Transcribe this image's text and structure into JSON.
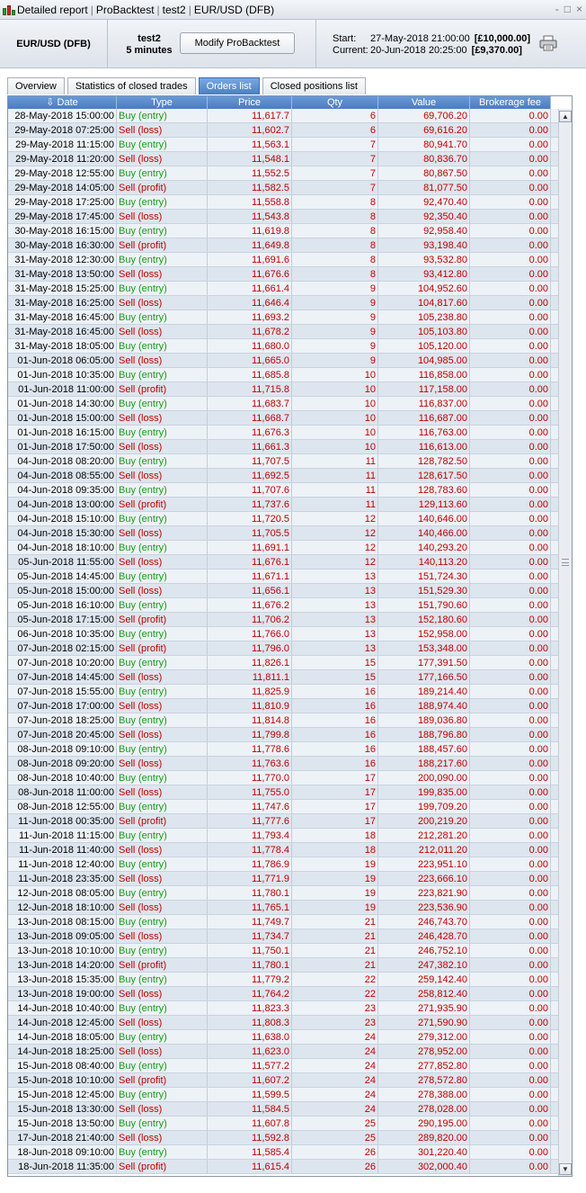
{
  "titlebar": {
    "crumbs": [
      "Detailed report",
      "ProBacktest",
      "test2",
      "EUR/USD (DFB)"
    ],
    "controls": [
      "-",
      "□",
      "×"
    ]
  },
  "header": {
    "instrument": "EUR/USD (DFB)",
    "strategy_name": "test2",
    "timeframe": "5 minutes",
    "modify_button": "Modify ProBacktest",
    "start_label": "Start:",
    "start_date": "27-May-2018 21:00:00",
    "start_amount": "[£10,000.00]",
    "current_label": "Current:",
    "current_date": "20-Jun-2018 20:25:00",
    "current_amount": "[£9,370.00]"
  },
  "tabs": [
    {
      "label": "Overview",
      "active": false
    },
    {
      "label": "Statistics of closed trades",
      "active": false
    },
    {
      "label": "Orders list",
      "active": true
    },
    {
      "label": "Closed positions list",
      "active": false
    }
  ],
  "columns": [
    "Date",
    "Type",
    "Price",
    "Qty",
    "Value",
    "Brokerage fee"
  ],
  "sort_icon": "arrow-down-icon",
  "orders": [
    [
      "28-May-2018 15:00:00",
      "Buy (entry)",
      "11,617.7",
      "6",
      "69,706.20",
      "0.00"
    ],
    [
      "29-May-2018 07:25:00",
      "Sell (loss)",
      "11,602.7",
      "6",
      "69,616.20",
      "0.00"
    ],
    [
      "29-May-2018 11:15:00",
      "Buy (entry)",
      "11,563.1",
      "7",
      "80,941.70",
      "0.00"
    ],
    [
      "29-May-2018 11:20:00",
      "Sell (loss)",
      "11,548.1",
      "7",
      "80,836.70",
      "0.00"
    ],
    [
      "29-May-2018 12:55:00",
      "Buy (entry)",
      "11,552.5",
      "7",
      "80,867.50",
      "0.00"
    ],
    [
      "29-May-2018 14:05:00",
      "Sell (profit)",
      "11,582.5",
      "7",
      "81,077.50",
      "0.00"
    ],
    [
      "29-May-2018 17:25:00",
      "Buy (entry)",
      "11,558.8",
      "8",
      "92,470.40",
      "0.00"
    ],
    [
      "29-May-2018 17:45:00",
      "Sell (loss)",
      "11,543.8",
      "8",
      "92,350.40",
      "0.00"
    ],
    [
      "30-May-2018 16:15:00",
      "Buy (entry)",
      "11,619.8",
      "8",
      "92,958.40",
      "0.00"
    ],
    [
      "30-May-2018 16:30:00",
      "Sell (profit)",
      "11,649.8",
      "8",
      "93,198.40",
      "0.00"
    ],
    [
      "31-May-2018 12:30:00",
      "Buy (entry)",
      "11,691.6",
      "8",
      "93,532.80",
      "0.00"
    ],
    [
      "31-May-2018 13:50:00",
      "Sell (loss)",
      "11,676.6",
      "8",
      "93,412.80",
      "0.00"
    ],
    [
      "31-May-2018 15:25:00",
      "Buy (entry)",
      "11,661.4",
      "9",
      "104,952.60",
      "0.00"
    ],
    [
      "31-May-2018 16:25:00",
      "Sell (loss)",
      "11,646.4",
      "9",
      "104,817.60",
      "0.00"
    ],
    [
      "31-May-2018 16:45:00",
      "Buy (entry)",
      "11,693.2",
      "9",
      "105,238.80",
      "0.00"
    ],
    [
      "31-May-2018 16:45:00",
      "Sell (loss)",
      "11,678.2",
      "9",
      "105,103.80",
      "0.00"
    ],
    [
      "31-May-2018 18:05:00",
      "Buy (entry)",
      "11,680.0",
      "9",
      "105,120.00",
      "0.00"
    ],
    [
      "01-Jun-2018 06:05:00",
      "Sell (loss)",
      "11,665.0",
      "9",
      "104,985.00",
      "0.00"
    ],
    [
      "01-Jun-2018 10:35:00",
      "Buy (entry)",
      "11,685.8",
      "10",
      "116,858.00",
      "0.00"
    ],
    [
      "01-Jun-2018 11:00:00",
      "Sell (profit)",
      "11,715.8",
      "10",
      "117,158.00",
      "0.00"
    ],
    [
      "01-Jun-2018 14:30:00",
      "Buy (entry)",
      "11,683.7",
      "10",
      "116,837.00",
      "0.00"
    ],
    [
      "01-Jun-2018 15:00:00",
      "Sell (loss)",
      "11,668.7",
      "10",
      "116,687.00",
      "0.00"
    ],
    [
      "01-Jun-2018 16:15:00",
      "Buy (entry)",
      "11,676.3",
      "10",
      "116,763.00",
      "0.00"
    ],
    [
      "01-Jun-2018 17:50:00",
      "Sell (loss)",
      "11,661.3",
      "10",
      "116,613.00",
      "0.00"
    ],
    [
      "04-Jun-2018 08:20:00",
      "Buy (entry)",
      "11,707.5",
      "11",
      "128,782.50",
      "0.00"
    ],
    [
      "04-Jun-2018 08:55:00",
      "Sell (loss)",
      "11,692.5",
      "11",
      "128,617.50",
      "0.00"
    ],
    [
      "04-Jun-2018 09:35:00",
      "Buy (entry)",
      "11,707.6",
      "11",
      "128,783.60",
      "0.00"
    ],
    [
      "04-Jun-2018 13:00:00",
      "Sell (profit)",
      "11,737.6",
      "11",
      "129,113.60",
      "0.00"
    ],
    [
      "04-Jun-2018 15:10:00",
      "Buy (entry)",
      "11,720.5",
      "12",
      "140,646.00",
      "0.00"
    ],
    [
      "04-Jun-2018 15:30:00",
      "Sell (loss)",
      "11,705.5",
      "12",
      "140,466.00",
      "0.00"
    ],
    [
      "04-Jun-2018 18:10:00",
      "Buy (entry)",
      "11,691.1",
      "12",
      "140,293.20",
      "0.00"
    ],
    [
      "05-Jun-2018 11:55:00",
      "Sell (loss)",
      "11,676.1",
      "12",
      "140,113.20",
      "0.00"
    ],
    [
      "05-Jun-2018 14:45:00",
      "Buy (entry)",
      "11,671.1",
      "13",
      "151,724.30",
      "0.00"
    ],
    [
      "05-Jun-2018 15:00:00",
      "Sell (loss)",
      "11,656.1",
      "13",
      "151,529.30",
      "0.00"
    ],
    [
      "05-Jun-2018 16:10:00",
      "Buy (entry)",
      "11,676.2",
      "13",
      "151,790.60",
      "0.00"
    ],
    [
      "05-Jun-2018 17:15:00",
      "Sell (profit)",
      "11,706.2",
      "13",
      "152,180.60",
      "0.00"
    ],
    [
      "06-Jun-2018 10:35:00",
      "Buy (entry)",
      "11,766.0",
      "13",
      "152,958.00",
      "0.00"
    ],
    [
      "07-Jun-2018 02:15:00",
      "Sell (profit)",
      "11,796.0",
      "13",
      "153,348.00",
      "0.00"
    ],
    [
      "07-Jun-2018 10:20:00",
      "Buy (entry)",
      "11,826.1",
      "15",
      "177,391.50",
      "0.00"
    ],
    [
      "07-Jun-2018 14:45:00",
      "Sell (loss)",
      "11,811.1",
      "15",
      "177,166.50",
      "0.00"
    ],
    [
      "07-Jun-2018 15:55:00",
      "Buy (entry)",
      "11,825.9",
      "16",
      "189,214.40",
      "0.00"
    ],
    [
      "07-Jun-2018 17:00:00",
      "Sell (loss)",
      "11,810.9",
      "16",
      "188,974.40",
      "0.00"
    ],
    [
      "07-Jun-2018 18:25:00",
      "Buy (entry)",
      "11,814.8",
      "16",
      "189,036.80",
      "0.00"
    ],
    [
      "07-Jun-2018 20:45:00",
      "Sell (loss)",
      "11,799.8",
      "16",
      "188,796.80",
      "0.00"
    ],
    [
      "08-Jun-2018 09:10:00",
      "Buy (entry)",
      "11,778.6",
      "16",
      "188,457.60",
      "0.00"
    ],
    [
      "08-Jun-2018 09:20:00",
      "Sell (loss)",
      "11,763.6",
      "16",
      "188,217.60",
      "0.00"
    ],
    [
      "08-Jun-2018 10:40:00",
      "Buy (entry)",
      "11,770.0",
      "17",
      "200,090.00",
      "0.00"
    ],
    [
      "08-Jun-2018 11:00:00",
      "Sell (loss)",
      "11,755.0",
      "17",
      "199,835.00",
      "0.00"
    ],
    [
      "08-Jun-2018 12:55:00",
      "Buy (entry)",
      "11,747.6",
      "17",
      "199,709.20",
      "0.00"
    ],
    [
      "11-Jun-2018 00:35:00",
      "Sell (profit)",
      "11,777.6",
      "17",
      "200,219.20",
      "0.00"
    ],
    [
      "11-Jun-2018 11:15:00",
      "Buy (entry)",
      "11,793.4",
      "18",
      "212,281.20",
      "0.00"
    ],
    [
      "11-Jun-2018 11:40:00",
      "Sell (loss)",
      "11,778.4",
      "18",
      "212,011.20",
      "0.00"
    ],
    [
      "11-Jun-2018 12:40:00",
      "Buy (entry)",
      "11,786.9",
      "19",
      "223,951.10",
      "0.00"
    ],
    [
      "11-Jun-2018 23:35:00",
      "Sell (loss)",
      "11,771.9",
      "19",
      "223,666.10",
      "0.00"
    ],
    [
      "12-Jun-2018 08:05:00",
      "Buy (entry)",
      "11,780.1",
      "19",
      "223,821.90",
      "0.00"
    ],
    [
      "12-Jun-2018 18:10:00",
      "Sell (loss)",
      "11,765.1",
      "19",
      "223,536.90",
      "0.00"
    ],
    [
      "13-Jun-2018 08:15:00",
      "Buy (entry)",
      "11,749.7",
      "21",
      "246,743.70",
      "0.00"
    ],
    [
      "13-Jun-2018 09:05:00",
      "Sell (loss)",
      "11,734.7",
      "21",
      "246,428.70",
      "0.00"
    ],
    [
      "13-Jun-2018 10:10:00",
      "Buy (entry)",
      "11,750.1",
      "21",
      "246,752.10",
      "0.00"
    ],
    [
      "13-Jun-2018 14:20:00",
      "Sell (profit)",
      "11,780.1",
      "21",
      "247,382.10",
      "0.00"
    ],
    [
      "13-Jun-2018 15:35:00",
      "Buy (entry)",
      "11,779.2",
      "22",
      "259,142.40",
      "0.00"
    ],
    [
      "13-Jun-2018 19:00:00",
      "Sell (loss)",
      "11,764.2",
      "22",
      "258,812.40",
      "0.00"
    ],
    [
      "14-Jun-2018 10:40:00",
      "Buy (entry)",
      "11,823.3",
      "23",
      "271,935.90",
      "0.00"
    ],
    [
      "14-Jun-2018 12:45:00",
      "Sell (loss)",
      "11,808.3",
      "23",
      "271,590.90",
      "0.00"
    ],
    [
      "14-Jun-2018 18:05:00",
      "Buy (entry)",
      "11,638.0",
      "24",
      "279,312.00",
      "0.00"
    ],
    [
      "14-Jun-2018 18:25:00",
      "Sell (loss)",
      "11,623.0",
      "24",
      "278,952.00",
      "0.00"
    ],
    [
      "15-Jun-2018 08:40:00",
      "Buy (entry)",
      "11,577.2",
      "24",
      "277,852.80",
      "0.00"
    ],
    [
      "15-Jun-2018 10:10:00",
      "Sell (profit)",
      "11,607.2",
      "24",
      "278,572.80",
      "0.00"
    ],
    [
      "15-Jun-2018 12:45:00",
      "Buy (entry)",
      "11,599.5",
      "24",
      "278,388.00",
      "0.00"
    ],
    [
      "15-Jun-2018 13:30:00",
      "Sell (loss)",
      "11,584.5",
      "24",
      "278,028.00",
      "0.00"
    ],
    [
      "15-Jun-2018 13:50:00",
      "Buy (entry)",
      "11,607.8",
      "25",
      "290,195.00",
      "0.00"
    ],
    [
      "17-Jun-2018 21:40:00",
      "Sell (loss)",
      "11,592.8",
      "25",
      "289,820.00",
      "0.00"
    ],
    [
      "18-Jun-2018 09:10:00",
      "Buy (entry)",
      "11,585.4",
      "26",
      "301,220.40",
      "0.00"
    ],
    [
      "18-Jun-2018 11:35:00",
      "Sell (profit)",
      "11,615.4",
      "26",
      "302,000.40",
      "0.00"
    ]
  ],
  "colors": {
    "buy": "#1a9a1a",
    "sell": "#c00000",
    "header": "#4a7cc0"
  }
}
